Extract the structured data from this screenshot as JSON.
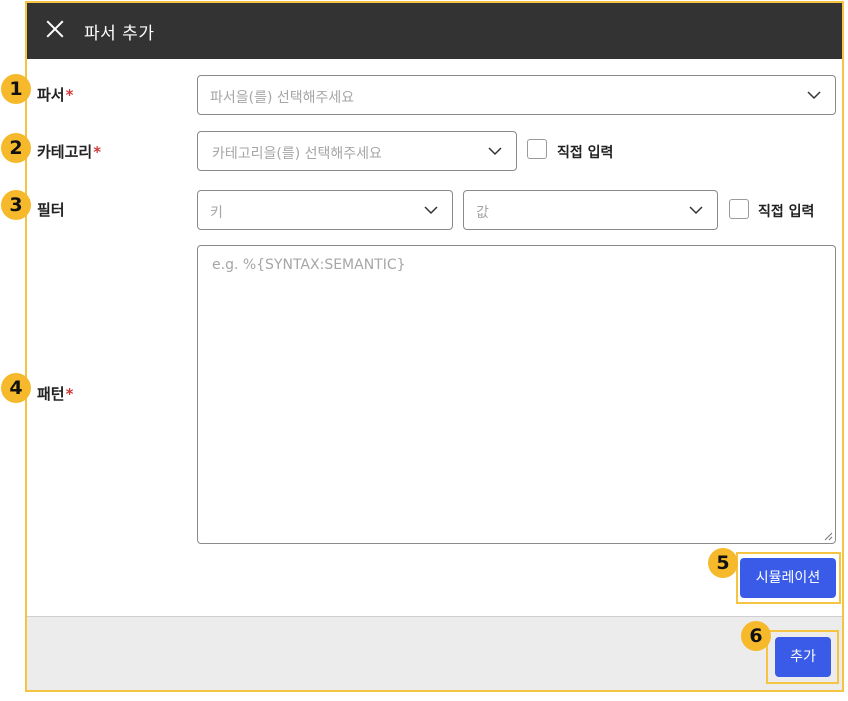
{
  "dialog": {
    "title": "파서 추가",
    "close_icon": "close-icon"
  },
  "annotations": [
    "1",
    "2",
    "3",
    "4",
    "5",
    "6"
  ],
  "fields": {
    "parser": {
      "label": "파서",
      "required_mark": "*",
      "placeholder": "파서을(를) 선택해주세요"
    },
    "category": {
      "label": "카테고리",
      "required_mark": "*",
      "placeholder": "카테고리을(를) 선택해주세요",
      "direct_input_label": "직접 입력"
    },
    "filter": {
      "label": "필터",
      "key_placeholder": "키",
      "value_placeholder": "값",
      "direct_input_label": "직접 입력"
    },
    "pattern": {
      "label": "패턴",
      "required_mark": "*",
      "placeholder": "e.g. %{SYNTAX:SEMANTIC}"
    }
  },
  "buttons": {
    "simulate": "시뮬레이션",
    "add": "추가"
  },
  "colors": {
    "header_bg": "#333333",
    "highlight": "#f6c443",
    "badge": "#f6b92b",
    "primary_button": "#3a5be8",
    "required": "#d03a3a"
  }
}
